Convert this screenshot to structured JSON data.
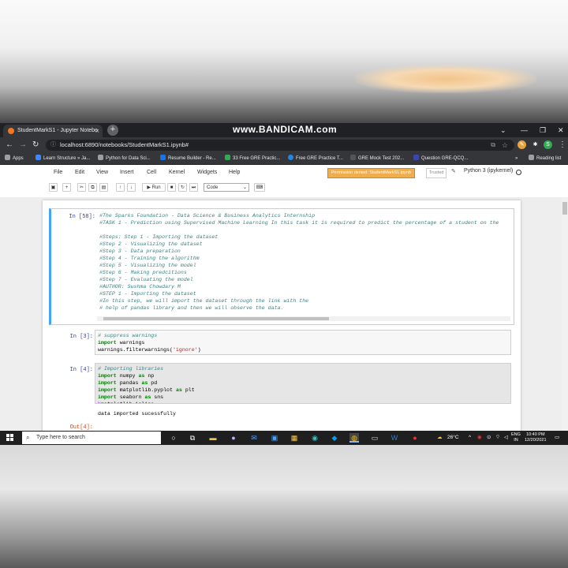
{
  "browser": {
    "tab_title": "StudentMarkS1 - Jupyter Notebo",
    "tab_close": "×",
    "new_tab": "+",
    "watermark": "www.BANDICAM.com",
    "url": "localhost:6890/notebooks/StudentMarkS1.ipynb#",
    "reading_list": "Reading list",
    "profile_initial": "S",
    "bookmarks": [
      {
        "label": "Apps",
        "color": "#5f6368"
      },
      {
        "label": "Learn Structure » Ja...",
        "color": "#4285f4"
      },
      {
        "label": "Python for Data Sci...",
        "color": "#9e9e9e"
      },
      {
        "label": "Resume Builder - Re...",
        "color": "#1a73e8"
      },
      {
        "label": "33 Free GRE Practic...",
        "color": "#34a853"
      },
      {
        "label": "Free GRE Practice T...",
        "color": "#1e88e5"
      },
      {
        "label": "GRE Mock Test 202...",
        "color": "#333333"
      },
      {
        "label": "Question GRE-QCQ...",
        "color": "#3949ab"
      }
    ]
  },
  "jupyter": {
    "menu": [
      "File",
      "Edit",
      "View",
      "Insert",
      "Cell",
      "Kernel",
      "Widgets",
      "Help"
    ],
    "permission": "Permission denied: StudentMarkS1.ipynb",
    "trusted": "Trusted",
    "kernel": "Python 3 (ipykernel)",
    "run_label": "Run",
    "cell_type": "Code"
  },
  "cells": [
    {
      "prompt": "In [58]:",
      "lines": [
        "#The Sparks Foundation - Data Science & Business Analytics Internship",
        "#TASK 1 - Prediction using Supervised Machine Learning In this task it is required to predict the percentage of a student on the",
        "",
        "#Steps: Step 1 - Importing the dataset",
        "#Step 2 - Visualizing the dataset",
        "#Step 3 - Data preparation",
        "#Step 4 - Training the algorithm",
        "#Step 5 - Visualizing the model",
        "#Step 6 - Making predcitions",
        "#Step 7 - Evaluating the model",
        "#AUTHOR: Sushma Chowdary M",
        "#STEP 1 - Importing the dataset",
        "#In this step, we will import the dataset through the link with the",
        "# help of pandas library and then we will observe the data."
      ]
    },
    {
      "prompt": "In [3]:",
      "line1_comment": "# suppress warnings",
      "line2_kw": "import",
      "line2_rest": " warnings",
      "line3_code": "warnings.filterwarnings(",
      "line3_str": "'ignore'",
      "line3_end": ")"
    },
    {
      "prompt": "In [4]:",
      "comment": "# Importing libraries",
      "imports": [
        {
          "kw": "import",
          "mod": " numpy ",
          "as": "as",
          "alias": " np"
        },
        {
          "kw": "import",
          "mod": " pandas ",
          "as": "as",
          "alias": " pd"
        },
        {
          "kw": "import",
          "mod": " matplotlib.pyplot ",
          "as": "as",
          "alias": " plt"
        },
        {
          "kw": "import",
          "mod": " seaborn ",
          "as": "as",
          "alias": " sns"
        }
      ],
      "magic": "%",
      "magic_rest": "matplotlib inline",
      "output": "data imported sucessfully"
    },
    {
      "prompt": "Out[4]:"
    }
  ],
  "taskbar": {
    "search_placeholder": "Type here to search",
    "weather": "26°C",
    "lang": "ENG",
    "region": "IN",
    "time": "10:40 PM",
    "date": "12/20/2021"
  }
}
